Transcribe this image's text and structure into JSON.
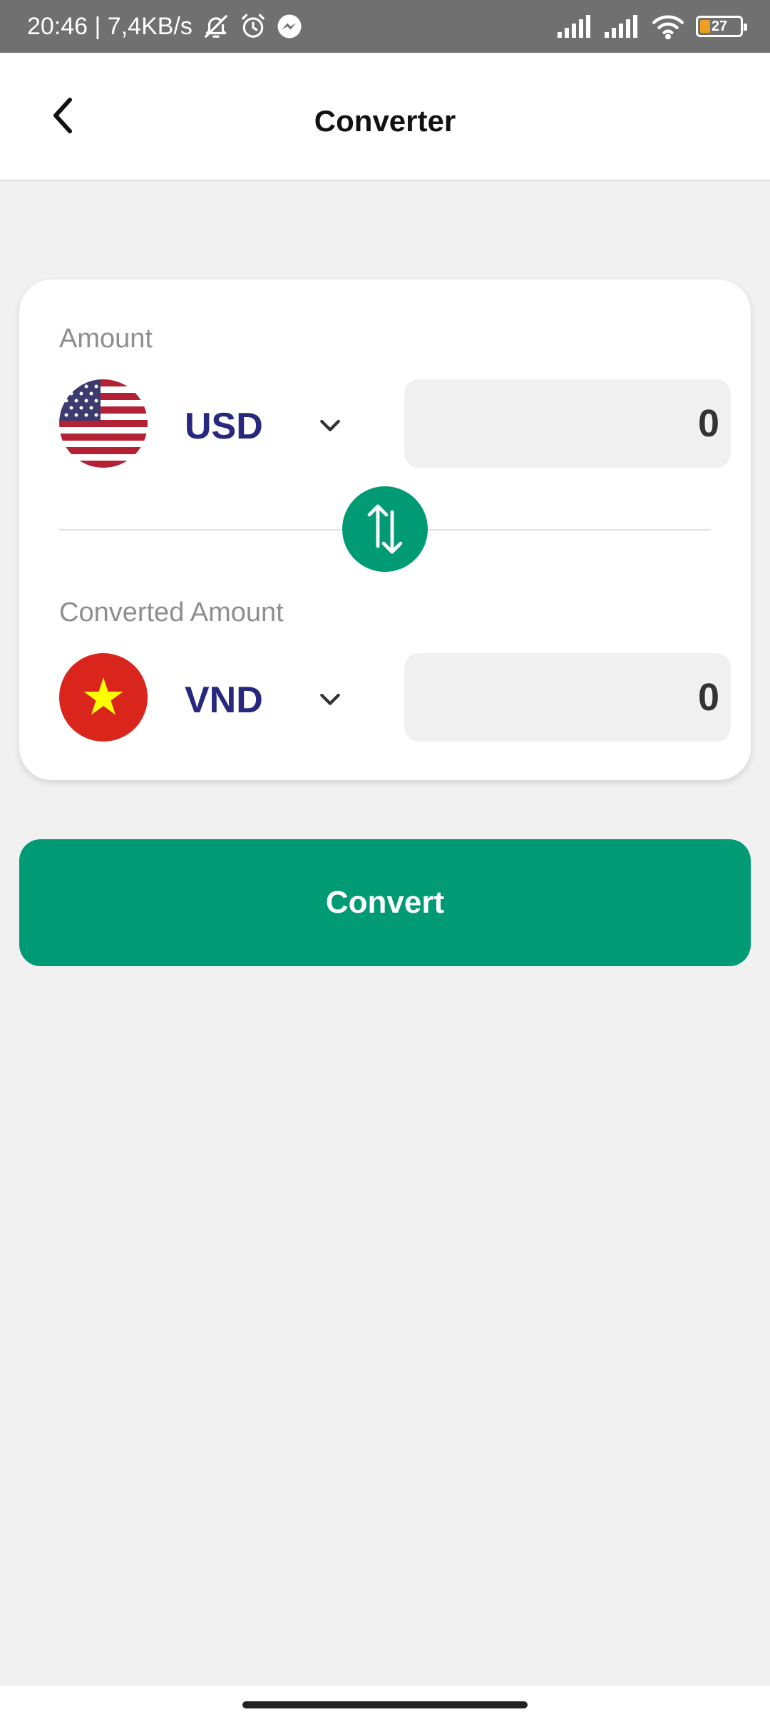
{
  "status_bar": {
    "time_speed": "20:46 | 7,4KB/s",
    "battery_level": "27",
    "icons": [
      "bell-off-icon",
      "alarm-icon",
      "messenger-icon",
      "signal-icon",
      "signal-icon",
      "wifi-icon",
      "battery-icon"
    ]
  },
  "app_bar": {
    "title": "Converter",
    "back_icon": "chevron-left-icon"
  },
  "converter": {
    "from": {
      "label": "Amount",
      "currency": "USD",
      "flag": "us-flag-icon",
      "amount": "0"
    },
    "swap_icon": "swap-vertical-icon",
    "to": {
      "label": "Converted Amount",
      "currency": "VND",
      "flag": "vietnam-flag-icon",
      "amount": "0"
    }
  },
  "convert_button": {
    "label": "Convert"
  },
  "colors": {
    "accent": "#009a75",
    "currency_text": "#27287e",
    "background": "#f1f1f1",
    "status_bar": "#707070"
  }
}
